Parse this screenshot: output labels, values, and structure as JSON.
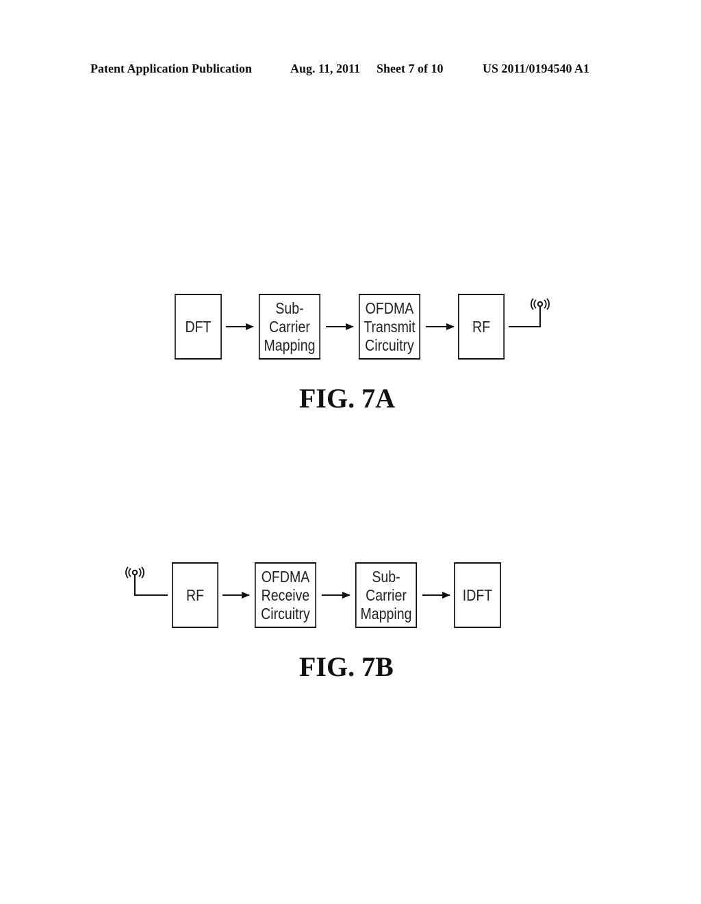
{
  "header": {
    "publication": "Patent Application Publication",
    "date": "Aug. 11, 2011",
    "sheet": "Sheet 7 of 10",
    "number": "US 2011/0194540 A1"
  },
  "fig7a": {
    "caption": "FIG. 7A",
    "blocks": [
      {
        "lines": [
          "DFT"
        ]
      },
      {
        "lines": [
          "Sub-",
          "Carrier",
          "Mapping"
        ]
      },
      {
        "lines": [
          "OFDMA",
          "Transmit",
          "Circuitry"
        ]
      },
      {
        "lines": [
          "RF"
        ]
      }
    ],
    "antenna": "antenna-icon"
  },
  "fig7b": {
    "caption": "FIG. 7B",
    "blocks": [
      {
        "lines": [
          "RF"
        ]
      },
      {
        "lines": [
          "OFDMA",
          "Receive",
          "Circuitry"
        ]
      },
      {
        "lines": [
          "Sub-",
          "Carrier",
          "Mapping"
        ]
      },
      {
        "lines": [
          "IDFT"
        ]
      }
    ],
    "antenna": "antenna-icon"
  }
}
